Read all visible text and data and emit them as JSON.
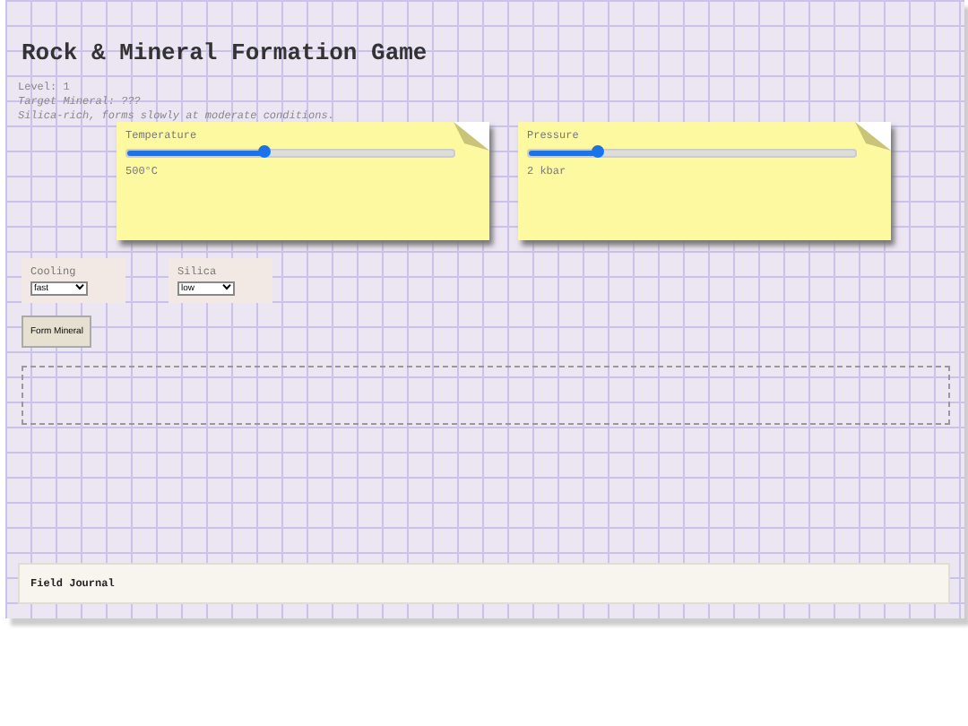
{
  "title": "Rock & Mineral Formation Game",
  "info": {
    "level": "Level: 1",
    "target": "Target Mineral: ???",
    "hint": "Silica-rich, forms slowly at moderate conditions."
  },
  "sliders": [
    {
      "label": "Temperature",
      "level": 0.42,
      "reading": "500°C"
    },
    {
      "label": "Pressure",
      "level": 0.21,
      "reading": "2 kbar"
    }
  ],
  "selects": [
    {
      "label": "Cooling",
      "value": "fast"
    },
    {
      "label": "Silica",
      "value": "low"
    }
  ],
  "button": "Form Mineral",
  "journal": {
    "title": "Field Journal"
  }
}
